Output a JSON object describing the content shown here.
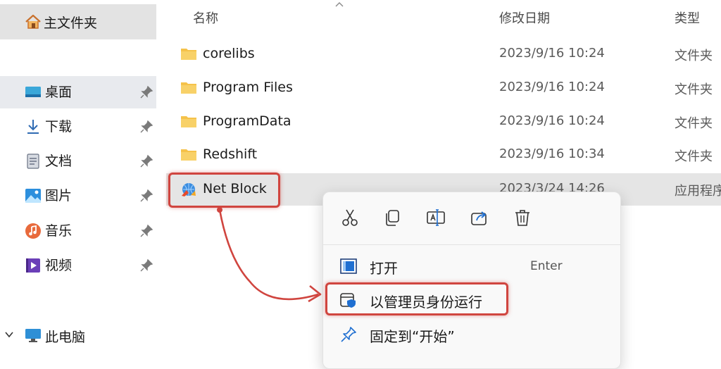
{
  "sidebar": {
    "home": {
      "label": "主文件夹",
      "icon": "home-icon"
    },
    "quick_access": [
      {
        "label": "桌面",
        "icon": "desktop-icon",
        "pinned": true,
        "active": true
      },
      {
        "label": "下载",
        "icon": "download-icon",
        "pinned": true
      },
      {
        "label": "文档",
        "icon": "document-icon",
        "pinned": true
      },
      {
        "label": "图片",
        "icon": "pictures-icon",
        "pinned": true
      },
      {
        "label": "音乐",
        "icon": "music-icon",
        "pinned": true
      },
      {
        "label": "视频",
        "icon": "video-icon",
        "pinned": true
      }
    ],
    "this_pc": {
      "label": "此电脑",
      "icon": "computer-icon",
      "expanded": false
    }
  },
  "file_list": {
    "columns": {
      "name": "名称",
      "modified": "修改日期",
      "type": "类型"
    },
    "rows": [
      {
        "name": "corelibs",
        "modified": "2023/9/16 10:24",
        "type": "文件夹",
        "icon": "folder-icon"
      },
      {
        "name": "Program Files",
        "modified": "2023/9/16 10:24",
        "type": "文件夹",
        "icon": "folder-icon"
      },
      {
        "name": "ProgramData",
        "modified": "2023/9/16 10:24",
        "type": "文件夹",
        "icon": "folder-icon"
      },
      {
        "name": "Redshift",
        "modified": "2023/9/16 10:34",
        "type": "文件夹",
        "icon": "folder-icon"
      },
      {
        "name": "Net Block",
        "modified": "2023/3/24 14:26",
        "type": "应用程序",
        "icon": "app-icon",
        "selected": true
      }
    ]
  },
  "context_menu": {
    "quick_actions": [
      "cut-icon",
      "copy-icon",
      "rename-icon",
      "share-icon",
      "delete-icon"
    ],
    "items": [
      {
        "label": "打开",
        "shortcut": "Enter",
        "icon": "open-icon"
      },
      {
        "label": "以管理员身份运行",
        "icon": "shield-icon",
        "highlighted": true
      },
      {
        "label": "固定到“开始”",
        "icon": "pin-icon"
      }
    ]
  },
  "colors": {
    "highlight_red": "#d0453f",
    "selection_gray": "#e5e5e5",
    "folder_yellow": "#f5c24a",
    "accent_blue": "#1f6fd1"
  }
}
